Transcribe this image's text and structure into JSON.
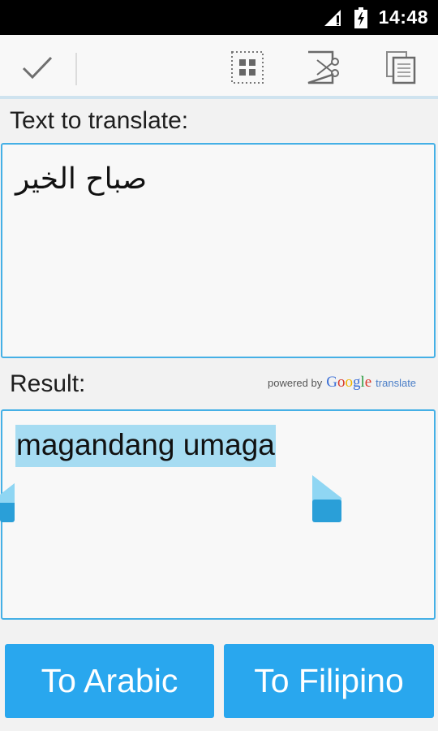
{
  "status_bar": {
    "time": "14:48",
    "icons": [
      "signal-icon",
      "battery-charging-icon"
    ]
  },
  "action_bar": {
    "done_icon": "check-icon",
    "actions": [
      "select-all-icon",
      "cut-icon",
      "copy-icon"
    ]
  },
  "input": {
    "label": "Text to translate:",
    "value": "صباح الخير"
  },
  "result": {
    "label": "Result:",
    "powered_by": "powered by",
    "google_logo": "Google",
    "translate": "translate",
    "value": "magandang umaga"
  },
  "buttons": {
    "to_source": "To Arabic",
    "to_target": "To Filipino"
  },
  "colors": {
    "accent": "#29a7ee",
    "selection": "#a6dcf2",
    "border": "#45b0e6"
  }
}
